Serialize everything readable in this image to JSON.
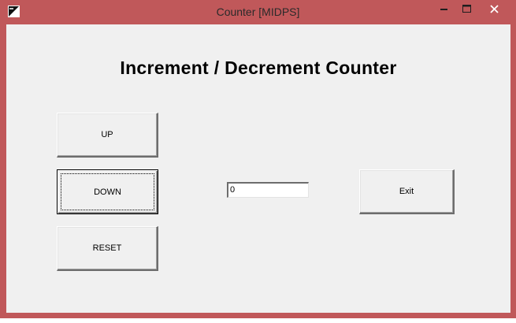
{
  "window": {
    "title": "Counter [MIDPS]",
    "frame_color": "#c0585a",
    "client_color": "#f0f0f0"
  },
  "titlebar_icons": {
    "app": "app-icon",
    "minimize": "minimize-icon",
    "maximize": "maximize-icon",
    "close": "close-icon"
  },
  "main": {
    "heading": "Increment / Decrement Counter",
    "buttons": {
      "up": "UP",
      "down": "DOWN",
      "reset": "RESET",
      "exit": "Exit"
    },
    "counter_value": "0",
    "focused_button": "DOWN"
  }
}
